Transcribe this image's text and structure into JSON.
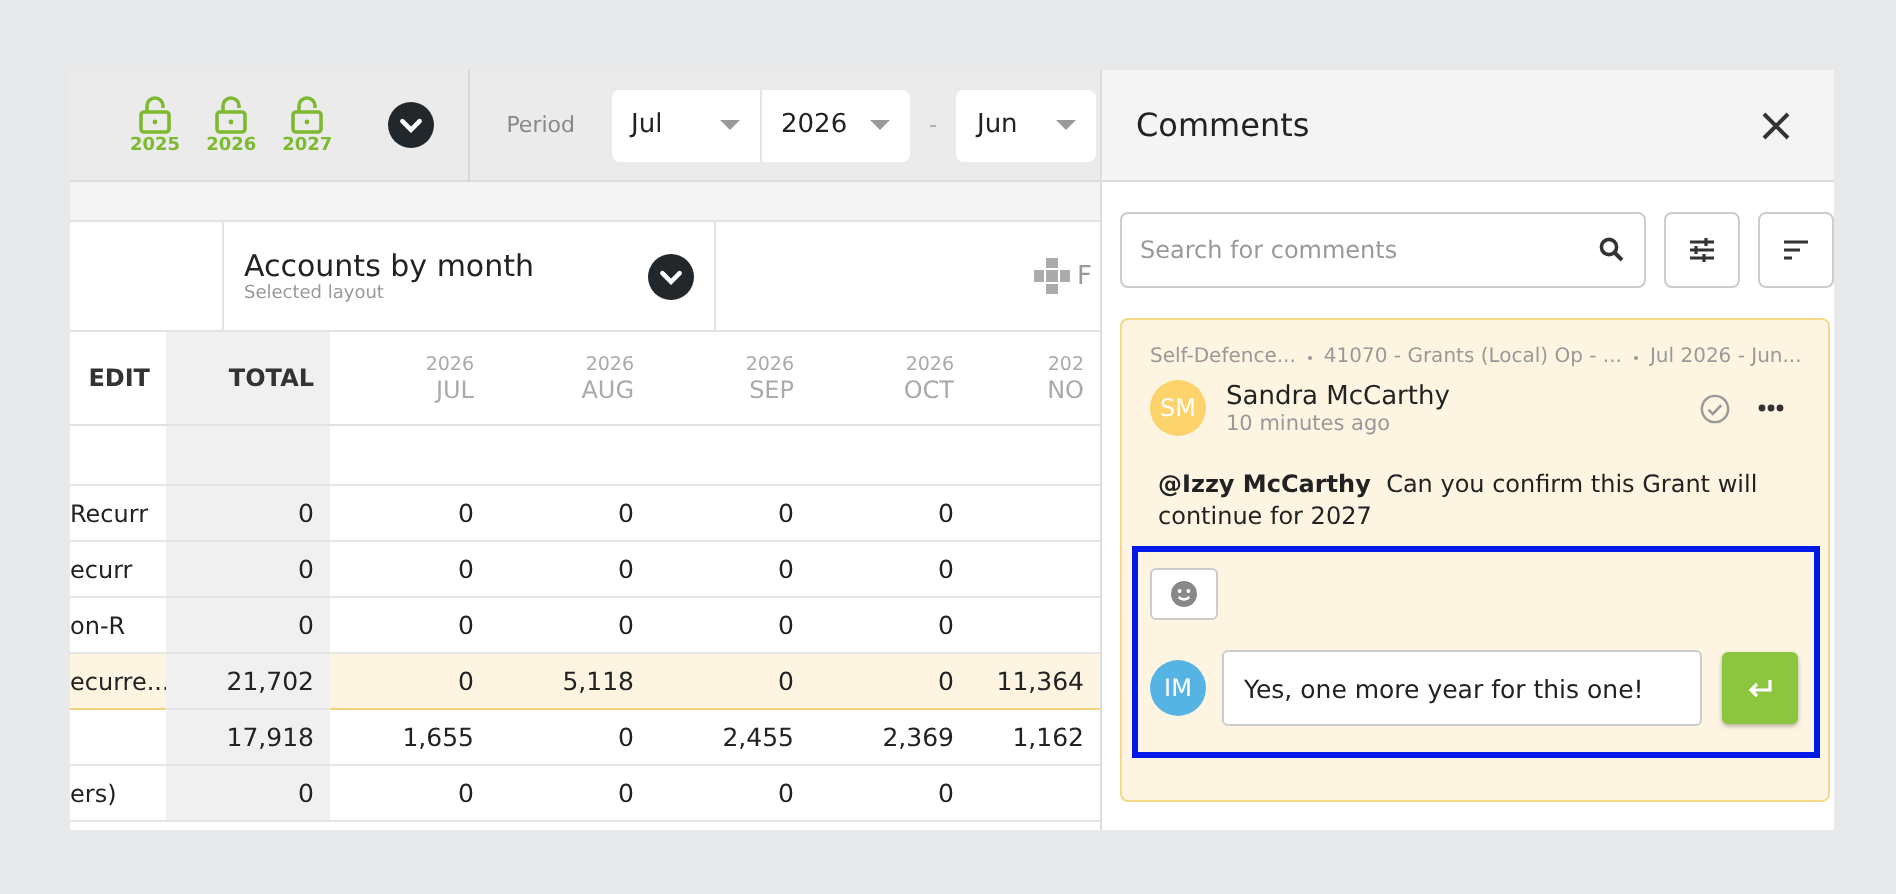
{
  "toolbar": {
    "locks": [
      {
        "year": "2025"
      },
      {
        "year": "2026"
      },
      {
        "year": "2027"
      }
    ],
    "period_label": "Period",
    "start_month": "Jul",
    "start_year": "2026",
    "separator": "-",
    "end_month": "Jun"
  },
  "layout": {
    "title": "Accounts by month",
    "subtitle": "Selected layout",
    "next_label": "F"
  },
  "table": {
    "columns": [
      {
        "label": "EDIT"
      },
      {
        "label": "TOTAL"
      },
      {
        "year": "2026",
        "label": "JUL"
      },
      {
        "year": "2026",
        "label": "AUG"
      },
      {
        "year": "2026",
        "label": "SEP"
      },
      {
        "year": "2026",
        "label": "OCT"
      },
      {
        "year": "202",
        "label": "NO"
      }
    ],
    "rows": [
      {
        "selected": false,
        "cells": [
          "",
          "",
          "",
          "",
          "",
          "",
          ""
        ]
      },
      {
        "selected": false,
        "cells": [
          "Recurr",
          "0",
          "0",
          "0",
          "0",
          "0",
          ""
        ]
      },
      {
        "selected": false,
        "cells": [
          "ecurr",
          "0",
          "0",
          "0",
          "0",
          "0",
          ""
        ]
      },
      {
        "selected": false,
        "cells": [
          "on-R",
          "0",
          "0",
          "0",
          "0",
          "0",
          ""
        ]
      },
      {
        "selected": true,
        "cells": [
          "ecurre...",
          "21,702",
          "0",
          "5,118",
          "0",
          "0",
          "11,364"
        ]
      },
      {
        "selected": false,
        "cells": [
          "",
          "17,918",
          "1,655",
          "0",
          "2,455",
          "2,369",
          "1,162"
        ]
      },
      {
        "selected": false,
        "cells": [
          "ers)",
          "0",
          "0",
          "0",
          "0",
          "0",
          ""
        ]
      }
    ]
  },
  "comments": {
    "title": "Comments",
    "search": {
      "placeholder": "Search for comments"
    },
    "comment": {
      "context": [
        "Self-Defence...",
        "41070 - Grants (Local) Op - ...",
        "Jul 2026 - Jun..."
      ],
      "initials": "SM",
      "author": "Sandra McCarthy",
      "time": "10 minutes ago",
      "resolved": false,
      "mention": "@Izzy McCarthy",
      "text": "Can you confirm this Grant will continue for 2027"
    },
    "reply": {
      "initials": "IM",
      "value": "Yes, one more year for this one!"
    }
  }
}
